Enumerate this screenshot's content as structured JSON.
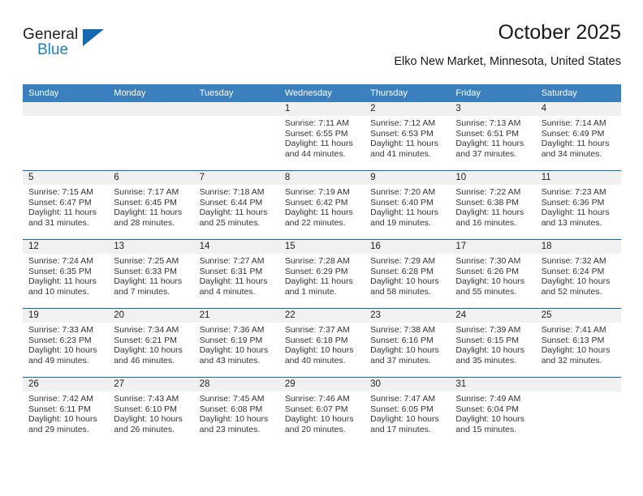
{
  "brand": {
    "name_part1": "General",
    "name_part2": "Blue",
    "triangle_icon": "triangle-icon",
    "accent_color": "#1668b0"
  },
  "header": {
    "title": "October 2025",
    "subtitle": "Elko New Market, Minnesota, United States"
  },
  "calendar": {
    "header_bg": "#3a7fbe",
    "row_divider_color": "#1668b0",
    "daynum_band_bg": "#f0f0f0",
    "weekdays": [
      "Sunday",
      "Monday",
      "Tuesday",
      "Wednesday",
      "Thursday",
      "Friday",
      "Saturday"
    ],
    "weeks": [
      [
        {
          "day": "",
          "sunrise": "",
          "sunset": "",
          "daylight1": "",
          "daylight2": ""
        },
        {
          "day": "",
          "sunrise": "",
          "sunset": "",
          "daylight1": "",
          "daylight2": ""
        },
        {
          "day": "",
          "sunrise": "",
          "sunset": "",
          "daylight1": "",
          "daylight2": ""
        },
        {
          "day": "1",
          "sunrise": "Sunrise: 7:11 AM",
          "sunset": "Sunset: 6:55 PM",
          "daylight1": "Daylight: 11 hours",
          "daylight2": "and 44 minutes."
        },
        {
          "day": "2",
          "sunrise": "Sunrise: 7:12 AM",
          "sunset": "Sunset: 6:53 PM",
          "daylight1": "Daylight: 11 hours",
          "daylight2": "and 41 minutes."
        },
        {
          "day": "3",
          "sunrise": "Sunrise: 7:13 AM",
          "sunset": "Sunset: 6:51 PM",
          "daylight1": "Daylight: 11 hours",
          "daylight2": "and 37 minutes."
        },
        {
          "day": "4",
          "sunrise": "Sunrise: 7:14 AM",
          "sunset": "Sunset: 6:49 PM",
          "daylight1": "Daylight: 11 hours",
          "daylight2": "and 34 minutes."
        }
      ],
      [
        {
          "day": "5",
          "sunrise": "Sunrise: 7:15 AM",
          "sunset": "Sunset: 6:47 PM",
          "daylight1": "Daylight: 11 hours",
          "daylight2": "and 31 minutes."
        },
        {
          "day": "6",
          "sunrise": "Sunrise: 7:17 AM",
          "sunset": "Sunset: 6:45 PM",
          "daylight1": "Daylight: 11 hours",
          "daylight2": "and 28 minutes."
        },
        {
          "day": "7",
          "sunrise": "Sunrise: 7:18 AM",
          "sunset": "Sunset: 6:44 PM",
          "daylight1": "Daylight: 11 hours",
          "daylight2": "and 25 minutes."
        },
        {
          "day": "8",
          "sunrise": "Sunrise: 7:19 AM",
          "sunset": "Sunset: 6:42 PM",
          "daylight1": "Daylight: 11 hours",
          "daylight2": "and 22 minutes."
        },
        {
          "day": "9",
          "sunrise": "Sunrise: 7:20 AM",
          "sunset": "Sunset: 6:40 PM",
          "daylight1": "Daylight: 11 hours",
          "daylight2": "and 19 minutes."
        },
        {
          "day": "10",
          "sunrise": "Sunrise: 7:22 AM",
          "sunset": "Sunset: 6:38 PM",
          "daylight1": "Daylight: 11 hours",
          "daylight2": "and 16 minutes."
        },
        {
          "day": "11",
          "sunrise": "Sunrise: 7:23 AM",
          "sunset": "Sunset: 6:36 PM",
          "daylight1": "Daylight: 11 hours",
          "daylight2": "and 13 minutes."
        }
      ],
      [
        {
          "day": "12",
          "sunrise": "Sunrise: 7:24 AM",
          "sunset": "Sunset: 6:35 PM",
          "daylight1": "Daylight: 11 hours",
          "daylight2": "and 10 minutes."
        },
        {
          "day": "13",
          "sunrise": "Sunrise: 7:25 AM",
          "sunset": "Sunset: 6:33 PM",
          "daylight1": "Daylight: 11 hours",
          "daylight2": "and 7 minutes."
        },
        {
          "day": "14",
          "sunrise": "Sunrise: 7:27 AM",
          "sunset": "Sunset: 6:31 PM",
          "daylight1": "Daylight: 11 hours",
          "daylight2": "and 4 minutes."
        },
        {
          "day": "15",
          "sunrise": "Sunrise: 7:28 AM",
          "sunset": "Sunset: 6:29 PM",
          "daylight1": "Daylight: 11 hours",
          "daylight2": "and 1 minute."
        },
        {
          "day": "16",
          "sunrise": "Sunrise: 7:29 AM",
          "sunset": "Sunset: 6:28 PM",
          "daylight1": "Daylight: 10 hours",
          "daylight2": "and 58 minutes."
        },
        {
          "day": "17",
          "sunrise": "Sunrise: 7:30 AM",
          "sunset": "Sunset: 6:26 PM",
          "daylight1": "Daylight: 10 hours",
          "daylight2": "and 55 minutes."
        },
        {
          "day": "18",
          "sunrise": "Sunrise: 7:32 AM",
          "sunset": "Sunset: 6:24 PM",
          "daylight1": "Daylight: 10 hours",
          "daylight2": "and 52 minutes."
        }
      ],
      [
        {
          "day": "19",
          "sunrise": "Sunrise: 7:33 AM",
          "sunset": "Sunset: 6:23 PM",
          "daylight1": "Daylight: 10 hours",
          "daylight2": "and 49 minutes."
        },
        {
          "day": "20",
          "sunrise": "Sunrise: 7:34 AM",
          "sunset": "Sunset: 6:21 PM",
          "daylight1": "Daylight: 10 hours",
          "daylight2": "and 46 minutes."
        },
        {
          "day": "21",
          "sunrise": "Sunrise: 7:36 AM",
          "sunset": "Sunset: 6:19 PM",
          "daylight1": "Daylight: 10 hours",
          "daylight2": "and 43 minutes."
        },
        {
          "day": "22",
          "sunrise": "Sunrise: 7:37 AM",
          "sunset": "Sunset: 6:18 PM",
          "daylight1": "Daylight: 10 hours",
          "daylight2": "and 40 minutes."
        },
        {
          "day": "23",
          "sunrise": "Sunrise: 7:38 AM",
          "sunset": "Sunset: 6:16 PM",
          "daylight1": "Daylight: 10 hours",
          "daylight2": "and 37 minutes."
        },
        {
          "day": "24",
          "sunrise": "Sunrise: 7:39 AM",
          "sunset": "Sunset: 6:15 PM",
          "daylight1": "Daylight: 10 hours",
          "daylight2": "and 35 minutes."
        },
        {
          "day": "25",
          "sunrise": "Sunrise: 7:41 AM",
          "sunset": "Sunset: 6:13 PM",
          "daylight1": "Daylight: 10 hours",
          "daylight2": "and 32 minutes."
        }
      ],
      [
        {
          "day": "26",
          "sunrise": "Sunrise: 7:42 AM",
          "sunset": "Sunset: 6:11 PM",
          "daylight1": "Daylight: 10 hours",
          "daylight2": "and 29 minutes."
        },
        {
          "day": "27",
          "sunrise": "Sunrise: 7:43 AM",
          "sunset": "Sunset: 6:10 PM",
          "daylight1": "Daylight: 10 hours",
          "daylight2": "and 26 minutes."
        },
        {
          "day": "28",
          "sunrise": "Sunrise: 7:45 AM",
          "sunset": "Sunset: 6:08 PM",
          "daylight1": "Daylight: 10 hours",
          "daylight2": "and 23 minutes."
        },
        {
          "day": "29",
          "sunrise": "Sunrise: 7:46 AM",
          "sunset": "Sunset: 6:07 PM",
          "daylight1": "Daylight: 10 hours",
          "daylight2": "and 20 minutes."
        },
        {
          "day": "30",
          "sunrise": "Sunrise: 7:47 AM",
          "sunset": "Sunset: 6:05 PM",
          "daylight1": "Daylight: 10 hours",
          "daylight2": "and 17 minutes."
        },
        {
          "day": "31",
          "sunrise": "Sunrise: 7:49 AM",
          "sunset": "Sunset: 6:04 PM",
          "daylight1": "Daylight: 10 hours",
          "daylight2": "and 15 minutes."
        },
        {
          "day": "",
          "sunrise": "",
          "sunset": "",
          "daylight1": "",
          "daylight2": ""
        }
      ]
    ]
  }
}
